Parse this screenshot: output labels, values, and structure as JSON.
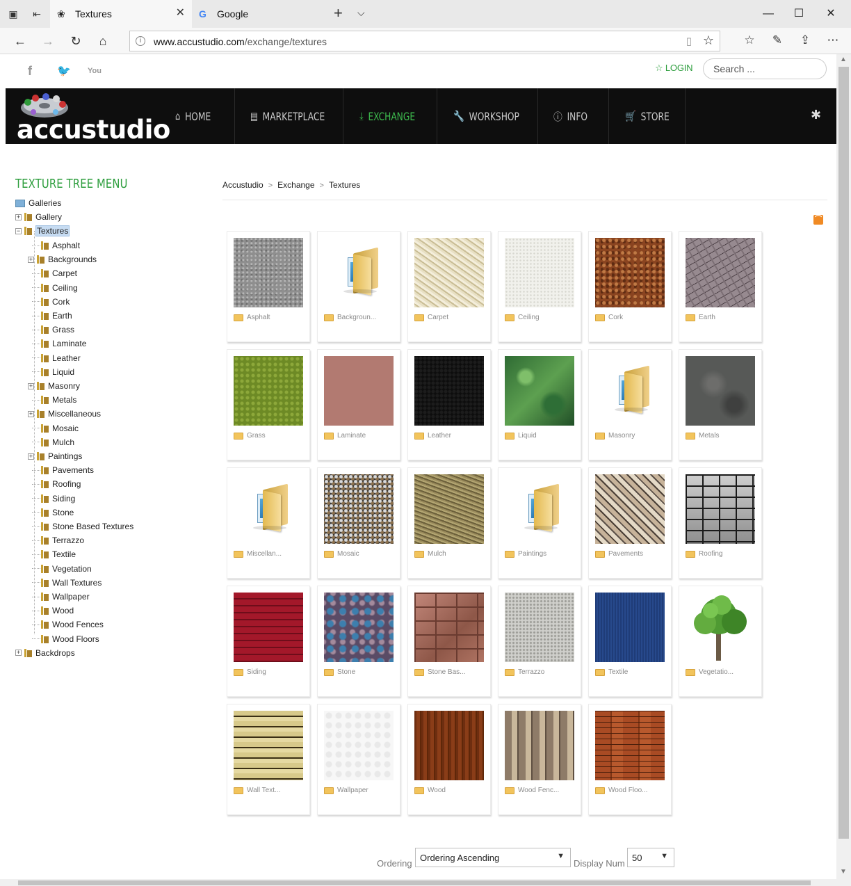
{
  "browser": {
    "tabs": [
      {
        "title": "Textures",
        "active": true
      },
      {
        "title": "Google",
        "active": false
      }
    ],
    "url_host": "www.accustudio.com",
    "url_path": "/exchange/textures"
  },
  "site": {
    "logo_text": "accustudio",
    "login_label": "LOGIN",
    "search_placeholder": "Search ...",
    "nav": [
      {
        "label": "HOME",
        "icon": "home-icon"
      },
      {
        "label": "MARKETPLACE",
        "icon": "store-icon"
      },
      {
        "label": "EXCHANGE",
        "icon": "download-icon",
        "active": true
      },
      {
        "label": "WORKSHOP",
        "icon": "wrench-icon"
      },
      {
        "label": "INFO",
        "icon": "info-icon"
      },
      {
        "label": "STORE",
        "icon": "cart-icon"
      }
    ],
    "accent_color": "#3dba4e"
  },
  "tree": {
    "title": "TEXTURE TREE MENU",
    "root": "Galleries",
    "top": [
      "Gallery",
      "Textures",
      "Backdrops"
    ],
    "children": [
      "Asphalt",
      "Backgrounds",
      "Carpet",
      "Ceiling",
      "Cork",
      "Earth",
      "Grass",
      "Laminate",
      "Leather",
      "Liquid",
      "Masonry",
      "Metals",
      "Miscellaneous",
      "Mosaic",
      "Mulch",
      "Paintings",
      "Pavements",
      "Roofing",
      "Siding",
      "Stone",
      "Stone Based Textures",
      "Terrazzo",
      "Textile",
      "Vegetation",
      "Wall Textures",
      "Wallpaper",
      "Wood",
      "Wood Fences",
      "Wood Floors"
    ]
  },
  "breadcrumb": [
    "Accustudio",
    "Exchange",
    "Textures"
  ],
  "grid": [
    {
      "caption": "Asphalt",
      "tex": "asphalt"
    },
    {
      "caption": "Backgroun...",
      "tex": "folder"
    },
    {
      "caption": "Carpet",
      "tex": "carpet"
    },
    {
      "caption": "Ceiling",
      "tex": "ceiling"
    },
    {
      "caption": "Cork",
      "tex": "cork"
    },
    {
      "caption": "Earth",
      "tex": "earth"
    },
    {
      "caption": "Grass",
      "tex": "grass"
    },
    {
      "caption": "Laminate",
      "tex": "laminate"
    },
    {
      "caption": "Leather",
      "tex": "leather"
    },
    {
      "caption": "Liquid",
      "tex": "liquid"
    },
    {
      "caption": "Masonry",
      "tex": "folder"
    },
    {
      "caption": "Metals",
      "tex": "metals"
    },
    {
      "caption": "Miscellan...",
      "tex": "folder"
    },
    {
      "caption": "Mosaic",
      "tex": "mosaic"
    },
    {
      "caption": "Mulch",
      "tex": "mulch"
    },
    {
      "caption": "Paintings",
      "tex": "folder"
    },
    {
      "caption": "Pavements",
      "tex": "pavements"
    },
    {
      "caption": "Roofing",
      "tex": "roofing"
    },
    {
      "caption": "Siding",
      "tex": "siding"
    },
    {
      "caption": "Stone",
      "tex": "stone"
    },
    {
      "caption": "Stone Bas...",
      "tex": "stonebas"
    },
    {
      "caption": "Terrazzo",
      "tex": "terrazzo"
    },
    {
      "caption": "Textile",
      "tex": "textile"
    },
    {
      "caption": "Vegetatio...",
      "tex": "tree"
    },
    {
      "caption": "Wall Text...",
      "tex": "walltext"
    },
    {
      "caption": "Wallpaper",
      "tex": "wallpaper"
    },
    {
      "caption": "Wood",
      "tex": "wood"
    },
    {
      "caption": "Wood Fenc...",
      "tex": "woodfenc"
    },
    {
      "caption": "Wood Floo...",
      "tex": "woodfloo"
    }
  ],
  "controls": {
    "ordering_label": "Ordering",
    "ordering_value": "Ordering Ascending",
    "display_label": "Display Num",
    "display_value": "50"
  }
}
